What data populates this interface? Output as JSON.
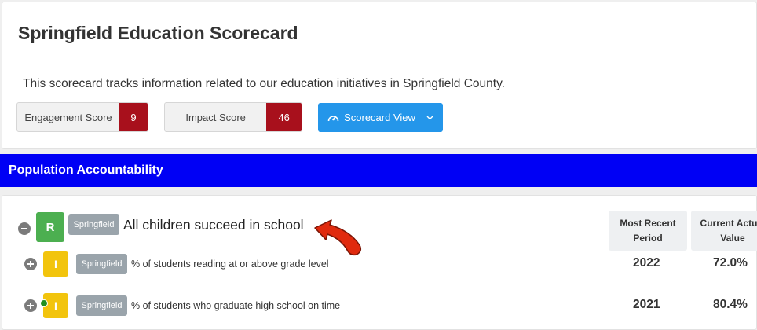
{
  "header": {
    "title": "Springfield Education Scorecard",
    "description": "This scorecard tracks information related to our education initiatives in Springfield County."
  },
  "scores": {
    "engagement_label": "Engagement Score",
    "engagement_value": "9",
    "impact_label": "Impact Score",
    "impact_value": "46"
  },
  "view_button": {
    "label": "Scorecard View",
    "icon": "dashboard-gauge-icon",
    "caret": "chevron-down-icon"
  },
  "section": {
    "title": "Population Accountability"
  },
  "columns": {
    "most_recent_period": "Most Recent Period",
    "current_actual_value": "Current Actual Value"
  },
  "result": {
    "badge": "R",
    "tag": "Springfield",
    "text": "All children succeed in school"
  },
  "measures": [
    {
      "badge": "I",
      "tag": "Springfield",
      "text": "% of students reading at or above grade level",
      "period": "2022",
      "value": "72.0%"
    },
    {
      "badge": "I",
      "tag": "Springfield",
      "text": "% of students who graduate high school on time",
      "period": "2021",
      "value": "80.4%"
    }
  ],
  "colors": {
    "section_bar": "#0000f5",
    "score_value": "#a8101c",
    "button": "#2496ea",
    "badge_result": "#4caf50",
    "badge_indicator": "#f2c40d",
    "tag": "#9aa4ab",
    "annotation_arrow": "#e02a0e"
  }
}
